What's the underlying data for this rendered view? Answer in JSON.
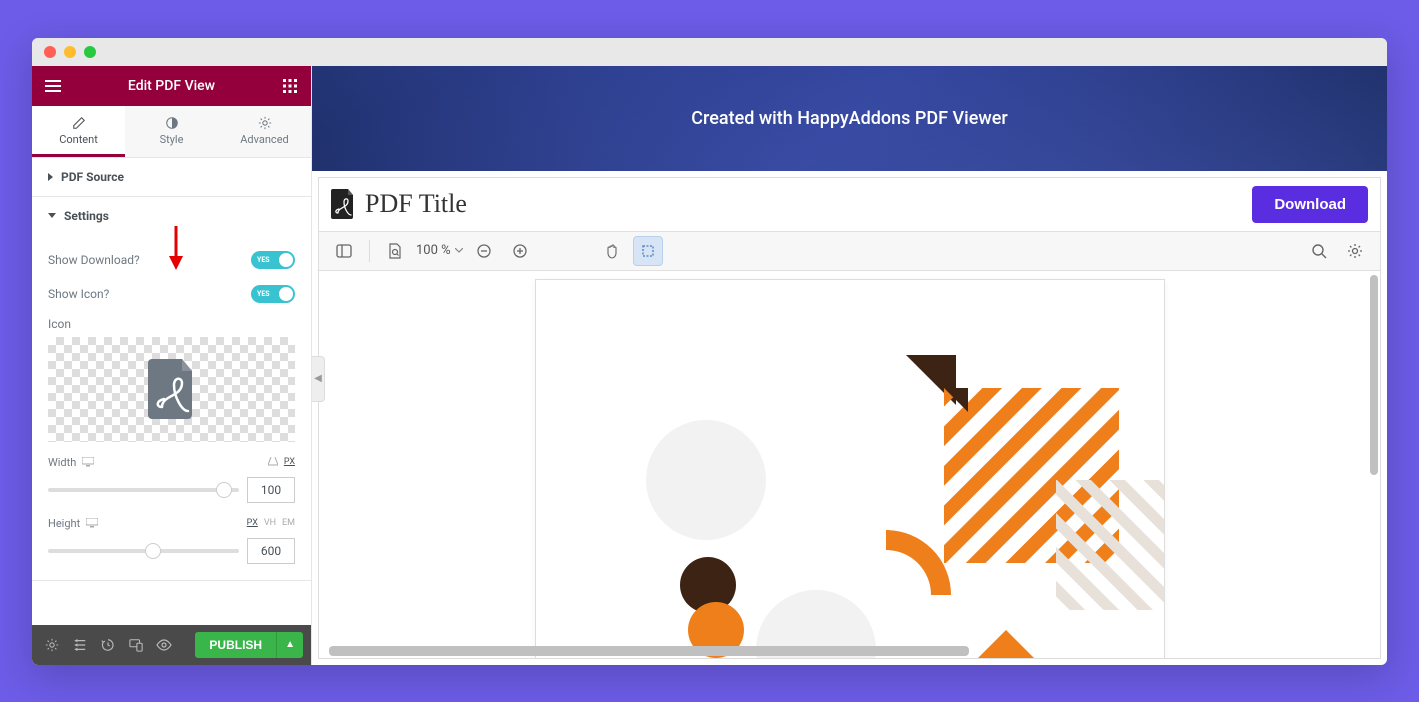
{
  "header": {
    "title": "Edit PDF View"
  },
  "tabs": [
    {
      "label": "Content",
      "active": true
    },
    {
      "label": "Style",
      "active": false
    },
    {
      "label": "Advanced",
      "active": false
    }
  ],
  "sections": {
    "pdfSource": {
      "title": "PDF Source"
    },
    "settings": {
      "title": "Settings",
      "showDownloadLabel": "Show Download?",
      "showIconLabel": "Show Icon?",
      "iconLabel": "Icon",
      "widthLabel": "Width",
      "widthValue": "100",
      "widthUnits": {
        "px": "PX"
      },
      "heightLabel": "Height",
      "heightValue": "600",
      "heightUnits": {
        "px": "PX",
        "vh": "VH",
        "em": "EM"
      },
      "toggleYes": "YES"
    }
  },
  "footer": {
    "publish": "PUBLISH"
  },
  "preview": {
    "bannerText": "Created with HappyAddons PDF Viewer",
    "pdfTitle": "PDF Title",
    "downloadLabel": "Download",
    "zoom": "100 %"
  }
}
